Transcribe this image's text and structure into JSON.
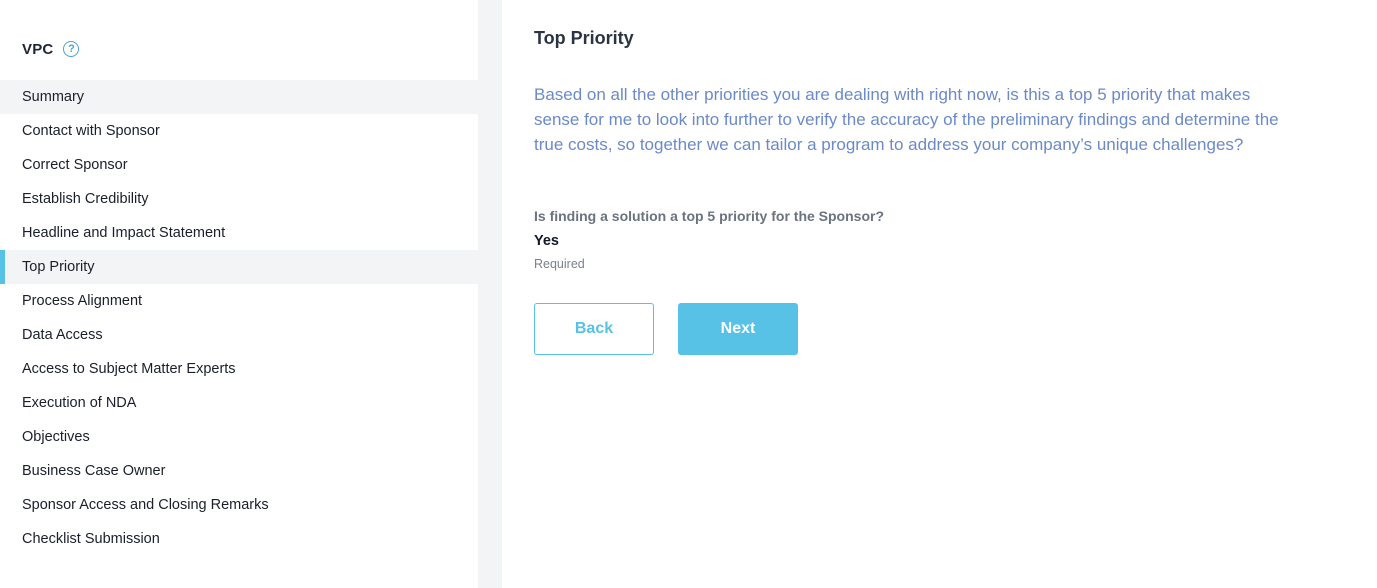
{
  "sidebar": {
    "title": "VPC",
    "help_icon": "question-circle-icon",
    "items": [
      {
        "label": "Summary",
        "state": "highlighted"
      },
      {
        "label": "Contact with Sponsor"
      },
      {
        "label": "Correct Sponsor"
      },
      {
        "label": "Establish Credibility"
      },
      {
        "label": "Headline and Impact Statement"
      },
      {
        "label": "Top Priority",
        "state": "active"
      },
      {
        "label": "Process Alignment"
      },
      {
        "label": "Data Access"
      },
      {
        "label": "Access to Subject Matter Experts"
      },
      {
        "label": "Execution of NDA"
      },
      {
        "label": "Objectives"
      },
      {
        "label": "Business Case Owner"
      },
      {
        "label": "Sponsor Access and Closing Remarks"
      },
      {
        "label": "Checklist Submission"
      }
    ]
  },
  "main": {
    "title": "Top Priority",
    "description": "Based on all the other priorities you are dealing with right now, is this a top 5 priority that makes sense for me to look into further to verify the accuracy of the preliminary findings and determine the true costs, so together we can tailor a program to address your company’s unique challenges?",
    "question": "Is finding a solution a top 5 priority for the Sponsor?",
    "answer": "Yes",
    "required_label": "Required",
    "back_label": "Back",
    "next_label": "Next"
  },
  "colors": {
    "accent": "#57c1e6",
    "description_text": "#6b8ac9",
    "panel_bg": "#f3f4f6"
  }
}
